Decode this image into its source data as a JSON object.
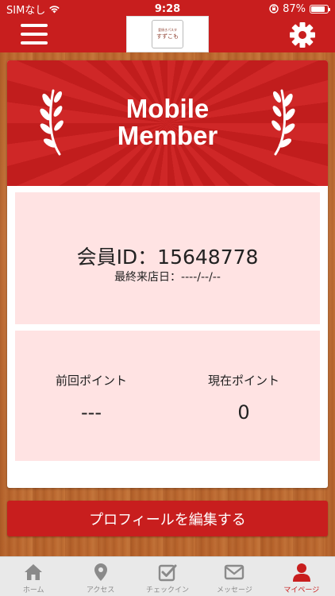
{
  "status_bar": {
    "carrier": "SIMなし",
    "time": "9:28",
    "battery": "87%",
    "battery_level": 0.87
  },
  "header": {
    "logo_sub": "釜焼きパスタ",
    "logo_text": "すずこも"
  },
  "banner": {
    "line1": "Mobile",
    "line2": "Member"
  },
  "member": {
    "id_line": "会員ID：15648778",
    "last_visit": "最終来店日：----/--/--"
  },
  "points": {
    "previous_label": "前回ポイント",
    "previous_value": "---",
    "current_label": "現在ポイント",
    "current_value": "0"
  },
  "profile_button": "プロフィールを編集する",
  "tabs": [
    {
      "label": "ホーム",
      "icon": "home-icon",
      "active": false
    },
    {
      "label": "アクセス",
      "icon": "location-pin-icon",
      "active": false
    },
    {
      "label": "チェックイン",
      "icon": "checkin-icon",
      "active": false
    },
    {
      "label": "メッセージ",
      "icon": "envelope-icon",
      "active": false
    },
    {
      "label": "マイページ",
      "icon": "person-icon",
      "active": true
    }
  ],
  "colors": {
    "brand_red": "#c81e1e",
    "panel_pink": "#ffe3e3",
    "tab_inactive": "#8a8a8a"
  }
}
